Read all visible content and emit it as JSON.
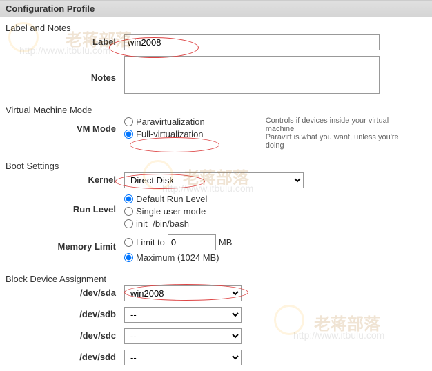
{
  "headers": {
    "config": "Configuration Profile",
    "label_notes": "Label and Notes",
    "vmmode": "Virtual Machine Mode",
    "boot": "Boot Settings",
    "block": "Block Device Assignment"
  },
  "labels": {
    "label": "Label",
    "notes": "Notes",
    "vmmode": "VM Mode",
    "kernel": "Kernel",
    "runlevel": "Run Level",
    "memlimit": "Memory Limit"
  },
  "fields": {
    "label_value": "win2008",
    "notes_value": ""
  },
  "vmmode": {
    "para": "Paravirtualization",
    "full": "Full-virtualization",
    "hint1": "Controls if devices inside your virtual machine",
    "hint2": "Paravirt is what you want, unless you're doing"
  },
  "kernel": {
    "value": "Direct Disk"
  },
  "runlevel": {
    "default": "Default Run Level",
    "single": "Single user mode",
    "init": "init=/bin/bash"
  },
  "memlimit": {
    "limitto": "Limit to",
    "mb": "MB",
    "max": "Maximum (1024 MB)",
    "val": "0"
  },
  "block": {
    "devs": [
      "/dev/sda",
      "/dev/sdb",
      "/dev/sdc",
      "/dev/sdd"
    ],
    "vals": [
      "win2008",
      "--",
      "--",
      "--"
    ]
  },
  "watermarks": {
    "cn": "老蒋部落",
    "url": "http://www.itbulu.com"
  }
}
